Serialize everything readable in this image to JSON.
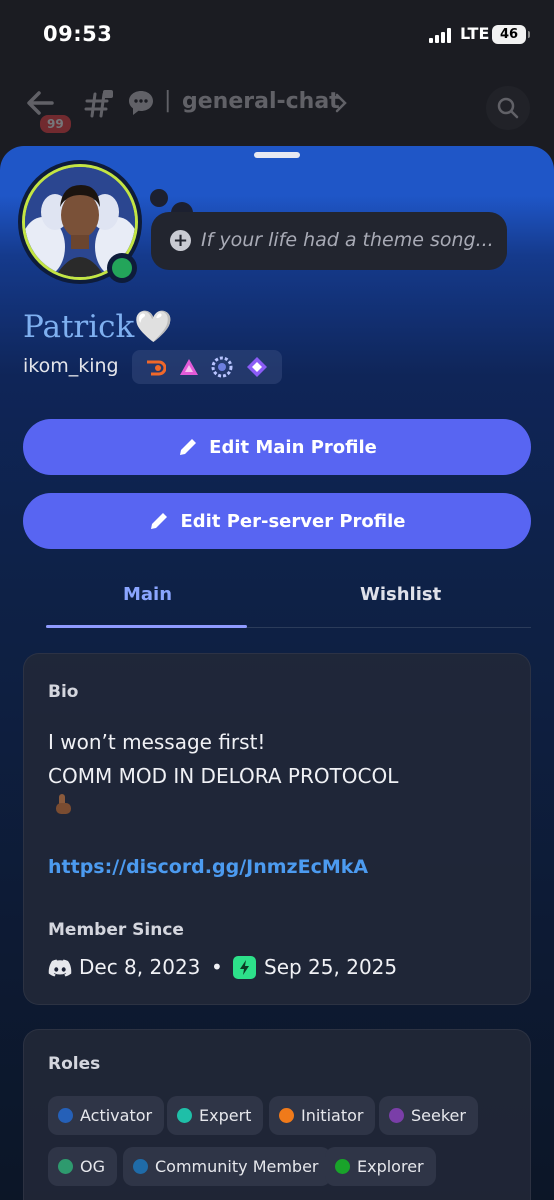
{
  "status_bar": {
    "time": "09:53",
    "carrier": "LTE",
    "battery": "46"
  },
  "channel_header": {
    "unread_count": "99",
    "separator": "|",
    "channel_name": "general-chat"
  },
  "profile": {
    "status_placeholder": "If your life had a theme song...",
    "display_name": "Patrick🤍",
    "username": "ikom_king",
    "badges": [
      "hypesquad-badge-icon",
      "triangle-badge-icon",
      "laurel-badge-icon",
      "quest-badge-icon"
    ],
    "online_color": "#23a55a",
    "avatar_ring_color": "#c3e544"
  },
  "actions": {
    "edit_main": "Edit Main Profile",
    "edit_server": "Edit Per-server Profile",
    "accent": "#5865f2"
  },
  "tabs": [
    {
      "label": "Main",
      "active": true
    },
    {
      "label": "Wishlist",
      "active": false
    }
  ],
  "bio": {
    "title": "Bio",
    "text": "I won’t message first!\nCOMM MOD IN DELORA PROTOCOL",
    "emoji": "pointing-down-icon",
    "link": "https://discord.gg/JnmzEcMkA"
  },
  "member_since": {
    "title": "Member Since",
    "discord_date": "Dec 8, 2023",
    "separator": "•",
    "server_date": "Sep 25, 2025"
  },
  "roles": {
    "title": "Roles",
    "items": [
      {
        "name": "Activator",
        "color": "#2560b8"
      },
      {
        "name": "Expert",
        "color": "#1fbfa8"
      },
      {
        "name": "Initiator",
        "color": "#f07a1a"
      },
      {
        "name": "Seeker",
        "color": "#7a3ea8"
      },
      {
        "name": "OG",
        "color": "#2e9a6e"
      },
      {
        "name": "Community Member",
        "color": "#1f6ba8"
      },
      {
        "name": "Explorer",
        "color": "#19a32a"
      }
    ]
  }
}
